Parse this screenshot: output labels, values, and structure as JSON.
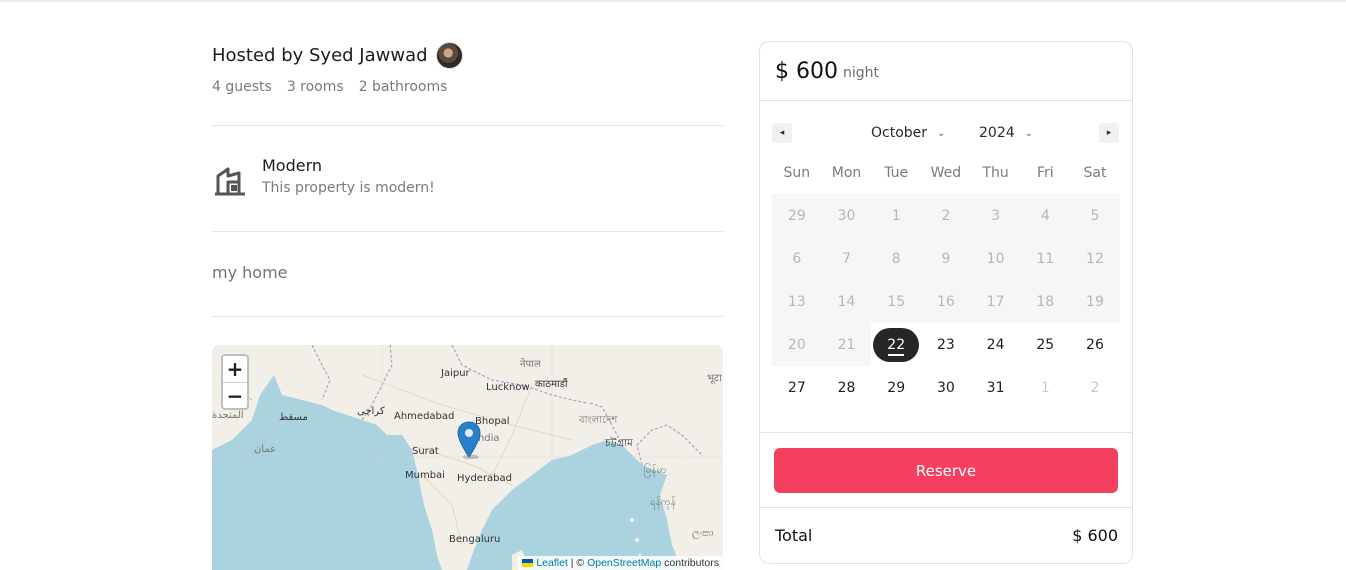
{
  "host": {
    "title": "Hosted by Syed Jawwad",
    "stats": [
      "4 guests",
      "3 rooms",
      "2 bathrooms"
    ]
  },
  "feature": {
    "icon": "building-icon",
    "title": "Modern",
    "subtitle": "This property is modern!"
  },
  "description": "my home",
  "map": {
    "zoom_in": "+",
    "zoom_out": "−",
    "labels": {
      "jaipur": "Jaipur",
      "lucknow": "Lucknow",
      "nepal": "नेपाल",
      "kathmandu": "काठमाडौं",
      "ahmedabad": "Ahmedabad",
      "bhopal": "Bhopal",
      "india": "India",
      "bangladesh": "বাংলাদেশ",
      "chattogram": "চট্টগ্রাম",
      "surat": "Surat",
      "mumbai": "Mumbai",
      "hyderabad": "Hyderabad",
      "bengaluru": "Bengaluru",
      "muscat": "مسقط",
      "karachi": "کراچی",
      "oman": "عمان",
      "uae": "المتحدة",
      "myanmar1": "မြန်မာ",
      "myanmar2": "ရန်ကုန်",
      "bhutan": "भूटा",
      "lanka": "ලංකා"
    },
    "attribution": {
      "leaflet": "Leaflet",
      "sep": " | © ",
      "osm": "OpenStreetMap",
      "contrib": " contributors"
    }
  },
  "booking": {
    "price": "$ 600",
    "unit": "night",
    "calendar": {
      "month": "October",
      "year": "2024",
      "prev_icon": "◂",
      "next_icon": "▸",
      "weekdays": [
        "Sun",
        "Mon",
        "Tue",
        "Wed",
        "Thu",
        "Fri",
        "Sat"
      ],
      "weeks": [
        [
          "29",
          "30",
          "1",
          "2",
          "3",
          "4",
          "5"
        ],
        [
          "6",
          "7",
          "8",
          "9",
          "10",
          "11",
          "12"
        ],
        [
          "13",
          "14",
          "15",
          "16",
          "17",
          "18",
          "19"
        ],
        [
          "20",
          "21",
          "22",
          "23",
          "24",
          "25",
          "26"
        ],
        [
          "27",
          "28",
          "29",
          "30",
          "31",
          "1",
          "2"
        ]
      ],
      "selected": "22"
    },
    "reserve_label": "Reserve",
    "total_label": "Total",
    "total_value": "$ 600"
  }
}
